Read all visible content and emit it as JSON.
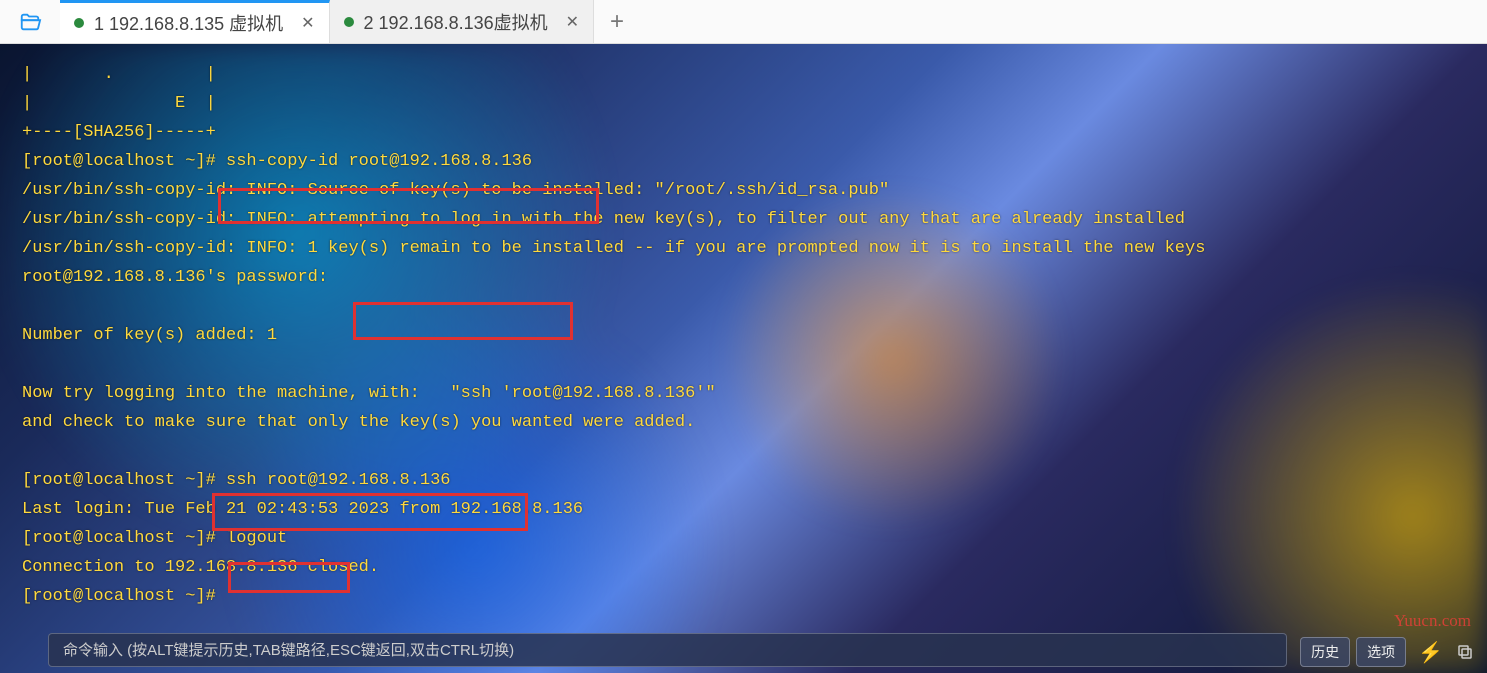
{
  "tabs": [
    {
      "label": "1 192.168.8.135  虚拟机",
      "active": true
    },
    {
      "label": "2 192.168.8.136虚拟机",
      "active": false
    }
  ],
  "terminal_lines": [
    "|       .         |",
    "|              E  |",
    "+----[SHA256]-----+",
    "[root@localhost ~]# ssh-copy-id root@192.168.8.136",
    "/usr/bin/ssh-copy-id: INFO: Source of key(s) to be installed: \"/root/.ssh/id_rsa.pub\"",
    "/usr/bin/ssh-copy-id: INFO: attempting to log in with the new key(s), to filter out any that are already installed",
    "/usr/bin/ssh-copy-id: INFO: 1 key(s) remain to be installed -- if you are prompted now it is to install the new keys",
    "root@192.168.8.136's password: ",
    "",
    "Number of key(s) added: 1",
    "",
    "Now try logging into the machine, with:   \"ssh 'root@192.168.8.136'\"",
    "and check to make sure that only the key(s) you wanted were added.",
    "",
    "[root@localhost ~]# ssh root@192.168.8.136",
    "Last login: Tue Feb 21 02:43:53 2023 from 192.168.8.136",
    "[root@localhost ~]# logout",
    "Connection to 192.168.8.136 closed.",
    "[root@localhost ~]# "
  ],
  "cmdbar": {
    "placeholder": "命令输入 (按ALT键提示历史,TAB键路径,ESC键返回,双击CTRL切换)"
  },
  "buttons": {
    "history": "历史",
    "options": "选项"
  },
  "watermark": "Yuucn.com"
}
